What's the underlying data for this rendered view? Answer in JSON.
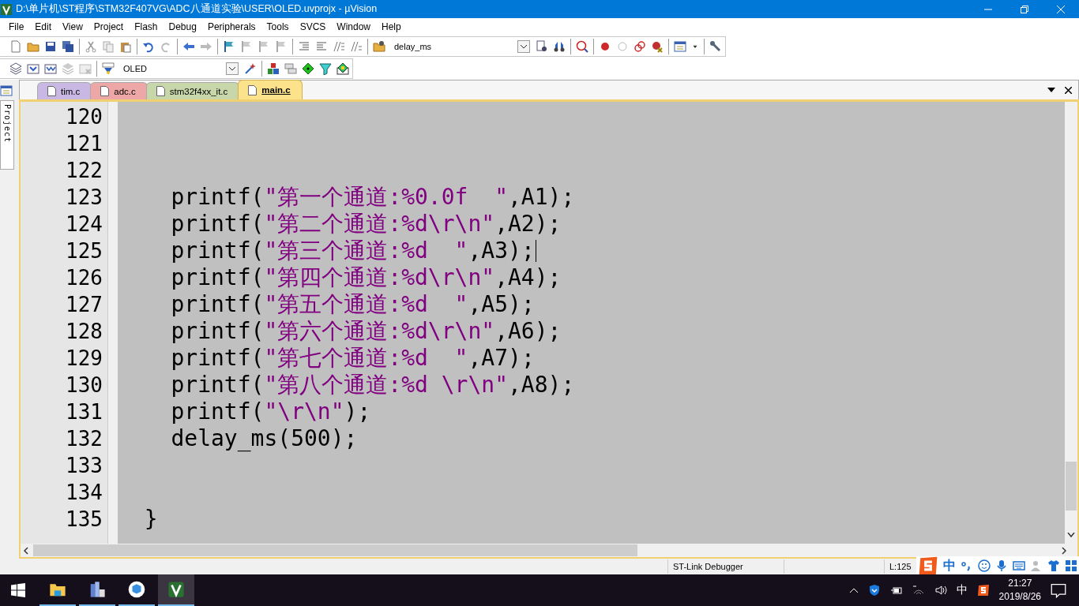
{
  "window": {
    "title": "D:\\单片机\\ST程序\\STM32F407VG\\ADC八通道实验\\USER\\OLED.uvprojx - µVision"
  },
  "menu": [
    "File",
    "Edit",
    "View",
    "Project",
    "Flash",
    "Debug",
    "Peripherals",
    "Tools",
    "SVCS",
    "Window",
    "Help"
  ],
  "toolbar": {
    "find_combo": "delay_ms",
    "target_combo": "OLED"
  },
  "sidebar": {
    "tab": "Project"
  },
  "tabs": [
    {
      "label": "tim.c",
      "selected": false,
      "color": "#c9b8e3"
    },
    {
      "label": "adc.c",
      "selected": false,
      "color": "#eea7a7"
    },
    {
      "label": "stm32f4xx_it.c",
      "selected": false,
      "color": "#c8d7a9"
    },
    {
      "label": "main.c",
      "selected": true,
      "color": "#fde28c"
    }
  ],
  "editor": {
    "lines": [
      {
        "number": "120",
        "cursor": false
      },
      {
        "number": "121",
        "cursor": false
      },
      {
        "number": "122",
        "cursor": false
      },
      {
        "number": "123",
        "cursor": false,
        "segments": [
          {
            "kind": "plain",
            "text": "    printf("
          },
          {
            "kind": "string",
            "text": "\"第一个通道:%0.0f  \""
          },
          {
            "kind": "plain",
            "text": ",A1);"
          }
        ]
      },
      {
        "number": "124",
        "cursor": false,
        "segments": [
          {
            "kind": "plain",
            "text": "    printf("
          },
          {
            "kind": "string",
            "text": "\"第二个通道:%d\\r\\n\""
          },
          {
            "kind": "plain",
            "text": ",A2);"
          }
        ]
      },
      {
        "number": "125",
        "cursor": true,
        "segments": [
          {
            "kind": "plain",
            "text": "    printf("
          },
          {
            "kind": "string",
            "text": "\"第三个通道:%d  \""
          },
          {
            "kind": "plain",
            "text": ",A3);"
          }
        ]
      },
      {
        "number": "126",
        "cursor": false,
        "segments": [
          {
            "kind": "plain",
            "text": "    printf("
          },
          {
            "kind": "string",
            "text": "\"第四个通道:%d\\r\\n\""
          },
          {
            "kind": "plain",
            "text": ",A4);"
          }
        ]
      },
      {
        "number": "127",
        "cursor": false,
        "segments": [
          {
            "kind": "plain",
            "text": "    printf("
          },
          {
            "kind": "string",
            "text": "\"第五个通道:%d  \""
          },
          {
            "kind": "plain",
            "text": ",A5);"
          }
        ]
      },
      {
        "number": "128",
        "cursor": false,
        "segments": [
          {
            "kind": "plain",
            "text": "    printf("
          },
          {
            "kind": "string",
            "text": "\"第六个通道:%d\\r\\n\""
          },
          {
            "kind": "plain",
            "text": ",A6);"
          }
        ]
      },
      {
        "number": "129",
        "cursor": false,
        "segments": [
          {
            "kind": "plain",
            "text": "    printf("
          },
          {
            "kind": "string",
            "text": "\"第七个通道:%d  \""
          },
          {
            "kind": "plain",
            "text": ",A7);"
          }
        ]
      },
      {
        "number": "130",
        "cursor": false,
        "segments": [
          {
            "kind": "plain",
            "text": "    printf("
          },
          {
            "kind": "string",
            "text": "\"第八个通道:%d \\r\\n\""
          },
          {
            "kind": "plain",
            "text": ",A8);"
          }
        ]
      },
      {
        "number": "131",
        "cursor": false,
        "segments": [
          {
            "kind": "plain",
            "text": "    printf("
          },
          {
            "kind": "string",
            "text": "\"\\r\\n\""
          },
          {
            "kind": "plain",
            "text": ");"
          }
        ]
      },
      {
        "number": "132",
        "cursor": false,
        "segments": [
          {
            "kind": "plain",
            "text": "    delay_ms(500);"
          }
        ]
      },
      {
        "number": "133",
        "cursor": false
      },
      {
        "number": "134",
        "cursor": false
      },
      {
        "number": "135",
        "cursor": false,
        "segments": [
          {
            "kind": "plain",
            "text": "  }"
          }
        ]
      }
    ]
  },
  "status_bar": {
    "debugger": "ST-Link Debugger",
    "position": "L:125"
  },
  "ime_bar": {
    "mode": "中"
  },
  "taskbar": {
    "tray_ime": "中",
    "time": "21:27",
    "date": "2019/8/26"
  }
}
